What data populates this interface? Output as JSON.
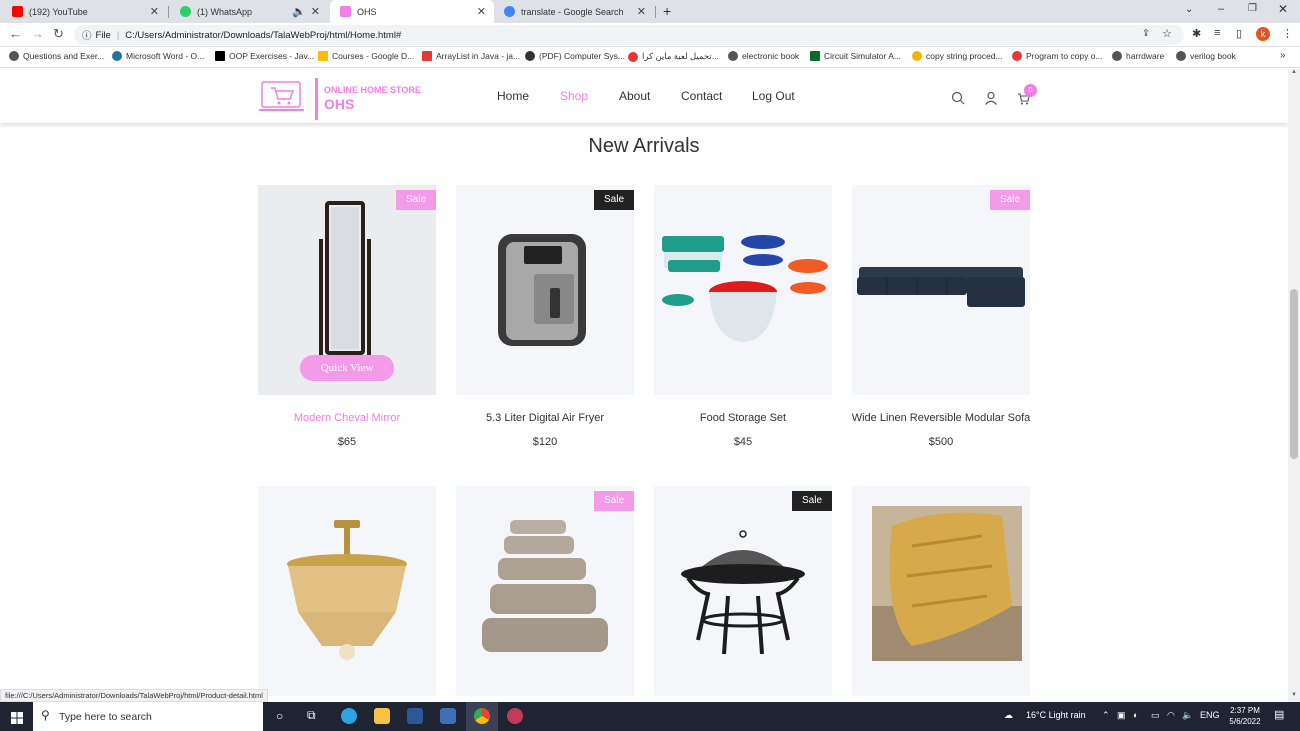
{
  "browser": {
    "tabs": [
      {
        "label": "(192) YouTube",
        "color": "#ff0000"
      },
      {
        "label": "(1) WhatsApp",
        "color": "#25d366"
      },
      {
        "label": "OHS",
        "color": "#f27ee8"
      },
      {
        "label": "translate - Google Search",
        "color": "#4285f4"
      }
    ],
    "new_tab": "+",
    "address_prefix": "File",
    "url": "C:/Users/Administrator/Downloads/TalaWebProj/html/Home.html#",
    "profile_letter": "k",
    "bookmarks": [
      "Questions and Exer...",
      "Microsoft Word - O...",
      "OOP Exercises - Jav...",
      "Courses - Google D...",
      "ArrayList in Java - ja...",
      "(PDF) Computer Sys...",
      "تحميل لعبة ماين كرا...",
      "electronic book",
      "Circuit Simulator A...",
      "copy string proced...",
      "Program to copy o...",
      "harrdware",
      "verilog book"
    ]
  },
  "site": {
    "logo_line1": "ONLINE HOME STORE",
    "logo_line2": "OHS",
    "menu": [
      "Home",
      "Shop",
      "About",
      "Contact",
      "Log Out"
    ],
    "cart_count": "0",
    "section_title": "New Arrivals",
    "quick_view": "Quick View",
    "sale_label": "Sale",
    "products": [
      {
        "name": "Modern Cheval Mirror",
        "price": "$65",
        "sale": "pink"
      },
      {
        "name": "5.3 Liter Digital Air Fryer",
        "price": "$120",
        "sale": "dark"
      },
      {
        "name": "Food Storage Set",
        "price": "$45",
        "sale": ""
      },
      {
        "name": "Wide Linen Reversible Modular Sofa",
        "price": "$500",
        "sale": "pink"
      },
      {
        "name": "",
        "price": "",
        "sale": ""
      },
      {
        "name": "",
        "price": "",
        "sale": "pink"
      },
      {
        "name": "",
        "price": "",
        "sale": "dark"
      },
      {
        "name": "",
        "price": "",
        "sale": ""
      }
    ]
  },
  "status_url": "file:///C:/Users/Administrator/Downloads/TalaWebProj/html/Product-detail.html",
  "taskbar": {
    "search_placeholder": "Type here to search",
    "weather": "16°C  Light rain",
    "lang": "ENG",
    "time": "2:37 PM",
    "date": "5/6/2022"
  },
  "colors": {
    "accent": "#f27ee8"
  }
}
